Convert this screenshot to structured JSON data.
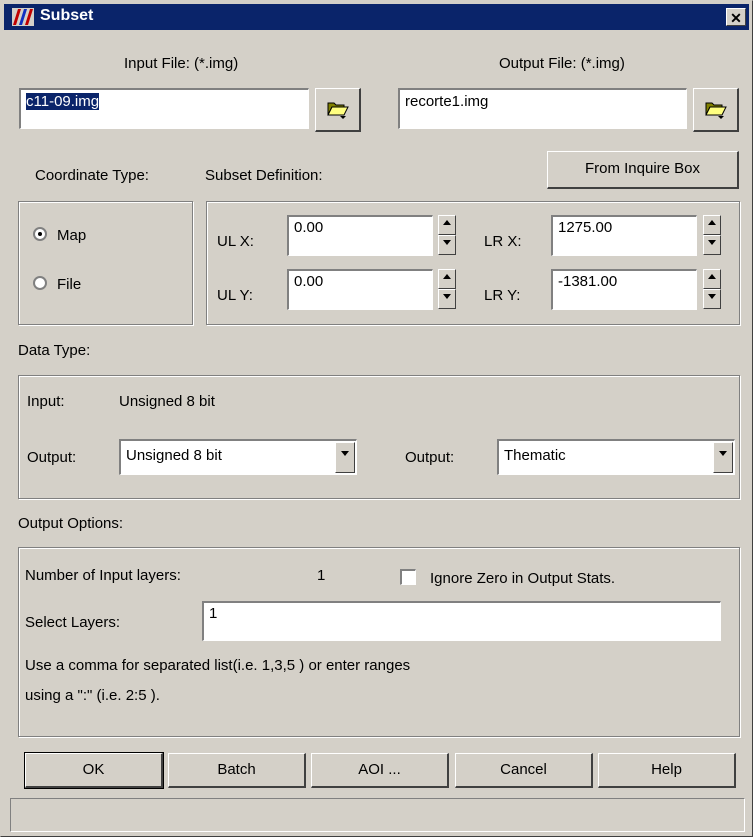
{
  "window": {
    "title": "Subset",
    "close_glyph": "✕"
  },
  "input_file": {
    "label": "Input File: (*.img)",
    "value": "c11-09.img",
    "browse_icon": "folder-open-icon"
  },
  "output_file": {
    "label": "Output File: (*.img)",
    "value": "recorte1.img",
    "browse_icon": "folder-open-icon"
  },
  "coordinate_type": {
    "label": "Coordinate Type:",
    "options": [
      {
        "label": "Map",
        "selected": true
      },
      {
        "label": "File",
        "selected": false
      }
    ]
  },
  "subset_definition": {
    "label": "Subset Definition:",
    "from_inquire_box_label": "From Inquire Box",
    "ulx_label": "UL X:",
    "ulx_value": "0.00",
    "uly_label": "UL Y:",
    "uly_value": "0.00",
    "lrx_label": "LR X:",
    "lrx_value": "1275.00",
    "lry_label": "LR Y:",
    "lry_value": "-1381.00"
  },
  "data_type": {
    "label": "Data Type:",
    "input_label": "Input:",
    "input_value": "Unsigned 8 bit",
    "output_label_1": "Output:",
    "output_value_1": "Unsigned 8 bit",
    "output_label_2": "Output:",
    "output_value_2": "Thematic"
  },
  "output_options": {
    "label": "Output Options:",
    "num_layers_label": "Number of Input layers:",
    "num_layers_value": "1",
    "ignore_zero_label": "Ignore Zero in Output Stats.",
    "ignore_zero_checked": false,
    "select_layers_label": "Select Layers:",
    "select_layers_value": "1",
    "help_line_1": "Use a comma for separated list(i.e. 1,3,5 ) or enter ranges",
    "help_line_2": "using a \":\" (i.e. 2:5 )."
  },
  "buttons": {
    "ok": "OK",
    "batch": "Batch",
    "aoi": "AOI ...",
    "cancel": "Cancel",
    "help": "Help"
  },
  "status_text": ""
}
